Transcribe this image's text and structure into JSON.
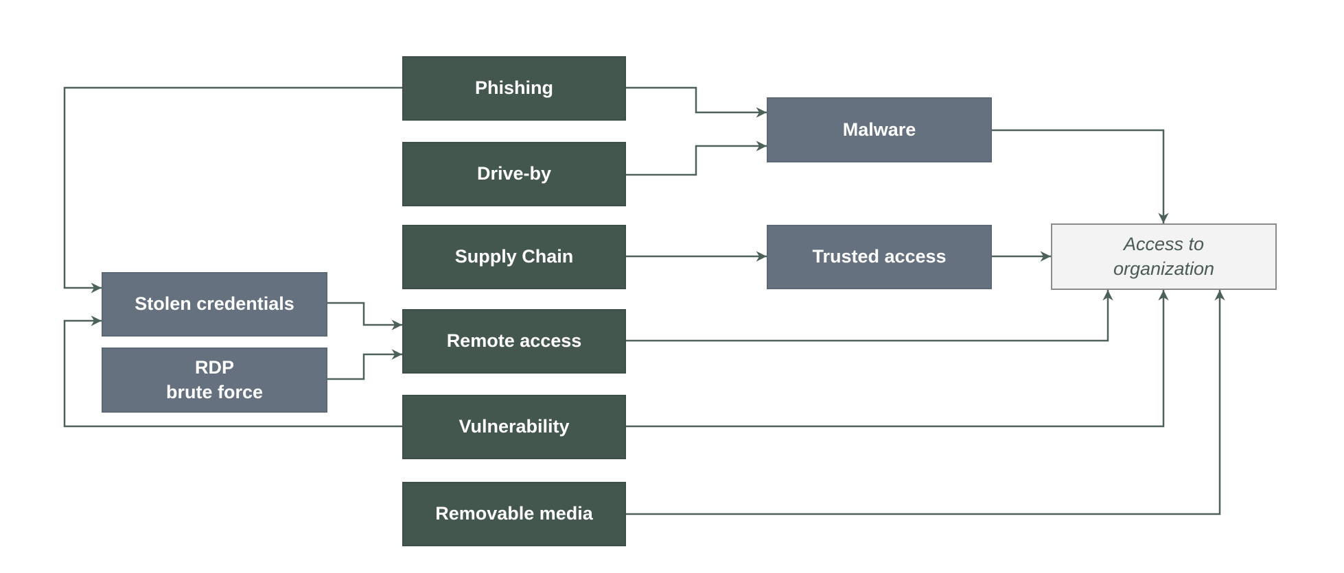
{
  "nodes": {
    "phishing": "Phishing",
    "drive_by": "Drive-by",
    "supply_chain": "Supply Chain",
    "remote_access": "Remote access",
    "vulnerability": "Vulnerability",
    "removable_media": "Removable media",
    "malware": "Malware",
    "trusted_access": "Trusted access",
    "access_to_organization": "Access to\norganization",
    "stolen_credentials": "Stolen credentials",
    "rdp_brute_force": "RDP\nbrute force"
  },
  "colors": {
    "vector_fill": "#44574f",
    "intermediate_fill": "#66717f",
    "target_fill": "#f3f3f3",
    "connector": "#4d615b"
  }
}
